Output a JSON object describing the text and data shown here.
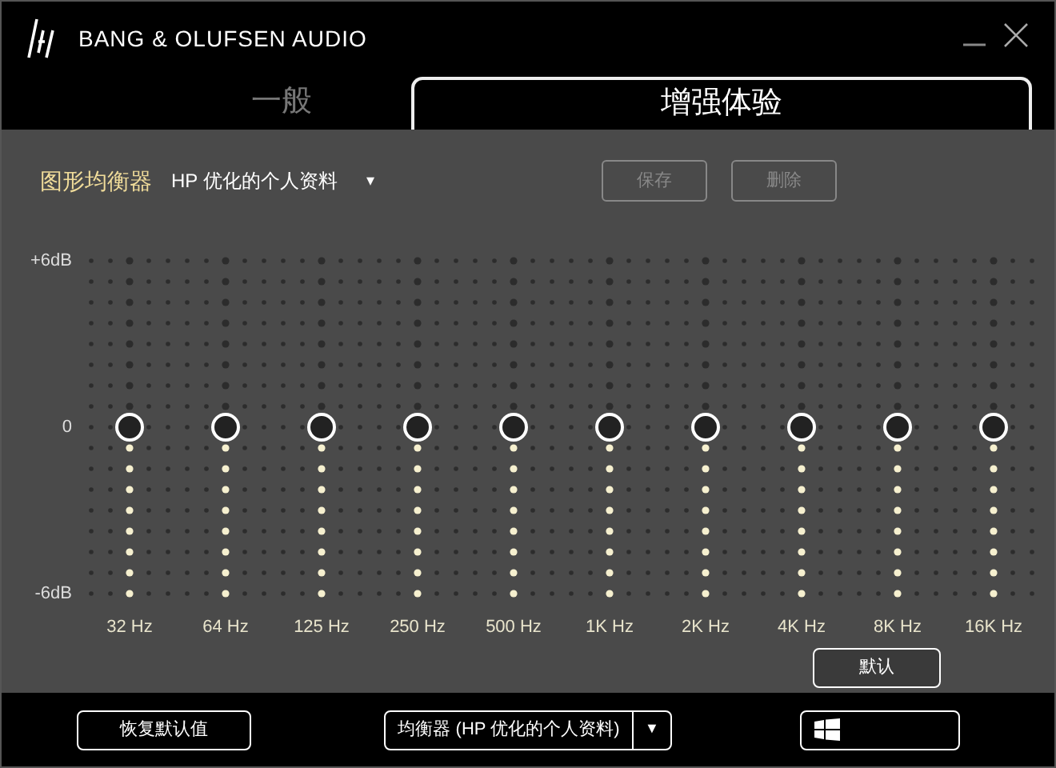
{
  "window": {
    "title": "BANG & OLUFSEN AUDIO"
  },
  "tabs": [
    {
      "label": "一般",
      "selected": false
    },
    {
      "label": "增强体验",
      "selected": true
    }
  ],
  "equalizer": {
    "label": "图形均衡器",
    "preset": "HP 优化的个人资料",
    "dropdown_arrow": "▾",
    "buttons": [
      {
        "label": "保存",
        "disabled": true
      },
      {
        "label": "删除",
        "disabled": true
      }
    ],
    "y_labels": [
      "+6dB",
      "0",
      "-6dB"
    ],
    "bands": [
      {
        "label": "32 Hz",
        "level": 0.5
      },
      {
        "label": "64 Hz",
        "level": 0.5
      },
      {
        "label": "125 Hz",
        "level": 0.5
      },
      {
        "label": "250 Hz",
        "level": 0.5
      },
      {
        "label": "500 Hz",
        "level": 0.5
      },
      {
        "label": "1K Hz",
        "level": 0.5
      },
      {
        "label": "2K Hz",
        "level": 0.5
      },
      {
        "label": "4K Hz",
        "level": 0.5
      },
      {
        "label": "8K Hz",
        "level": 0.5
      },
      {
        "label": "16K Hz",
        "level": 0.5
      }
    ],
    "default_button": "默认"
  },
  "footer": {
    "restore_button": "恢复默认值",
    "profile_select": {
      "value": "均衡器 (HP 优化的个人资料)",
      "arrow": "▼"
    }
  }
}
